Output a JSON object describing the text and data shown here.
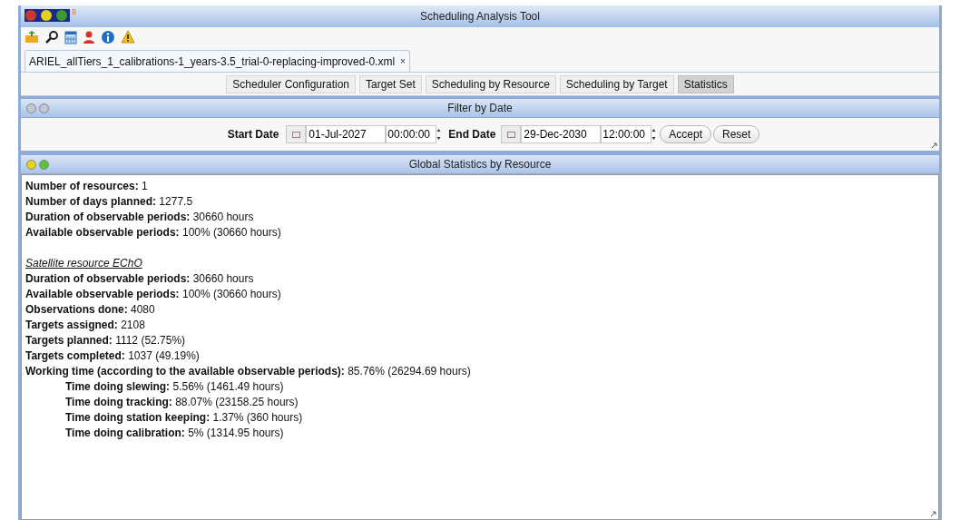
{
  "window": {
    "title": "Scheduling Analysis Tool",
    "logo_mark": "9"
  },
  "file_tab": {
    "label": "ARIEL_allTiers_1_calibrations-1_years-3.5_trial-0-replacing-improved-0.xml",
    "close": "×",
    "selected": true
  },
  "tabs": [
    {
      "label": "Scheduler Configuration",
      "selected": false
    },
    {
      "label": "Target Set",
      "selected": false
    },
    {
      "label": "Scheduling by Resource",
      "selected": false
    },
    {
      "label": "Scheduling by Target",
      "selected": false
    },
    {
      "label": "Statistics",
      "selected": true
    }
  ],
  "filter_panel": {
    "title": "Filter by Date",
    "dots": [
      {
        "color": "#c3c8d0"
      },
      {
        "color": "#c3c8d0"
      }
    ],
    "start_label": "Start Date",
    "start_date": "01-Jul-2027",
    "start_time": "00:00:00",
    "end_label": "End Date",
    "end_date": "29-Dec-2030",
    "end_time": "12:00:00",
    "buttons": [
      "Accept",
      "Reset"
    ]
  },
  "stats_panel": {
    "title": "Global Statistics by Resource",
    "dots": [
      {
        "color": "#e8d21a"
      },
      {
        "color": "#5cc23a"
      }
    ],
    "lines": [
      {
        "kind": "stat",
        "text": "**Number of resources:** 1"
      },
      {
        "kind": "stat",
        "text": "**Number of days planned:** 1277.5"
      },
      {
        "kind": "stat",
        "text": "**Duration of observable periods:** 30660 hours"
      },
      {
        "kind": "stat",
        "text": "**Available observable periods:** 100% (30660 hours)"
      },
      {
        "kind": "heading",
        "text": "Satellite resource EChO"
      },
      {
        "kind": "stat",
        "text": "**Duration of observable periods:** 30660 hours"
      },
      {
        "kind": "stat",
        "text": "**Available observable periods:** 100% (30660 hours)"
      },
      {
        "kind": "stat",
        "text": "**Observations done:** 4080"
      },
      {
        "kind": "stat",
        "text": "**Targets assigned:** 2108"
      },
      {
        "kind": "stat",
        "text": "**Targets planned:** 1112 (52.75%)"
      },
      {
        "kind": "stat",
        "text": "**Targets completed:** 1037 (49.19%)"
      },
      {
        "kind": "stat",
        "text": "**Working time (according to the available observable periods):** 85.76% (26294.69 hours)",
        "children": [
          {
            "kind": "stat",
            "text": "**Time doing slewing:** 5.56% (1461.49 hours)"
          },
          {
            "kind": "stat",
            "text": "**Time doing tracking:** 88.07% (23158.25 hours)"
          },
          {
            "kind": "stat",
            "text": "**Time doing station keeping:** 1.37% (360 hours)"
          },
          {
            "kind": "stat",
            "text": "**Time doing calibration:** 5% (1314.95 hours)"
          }
        ]
      }
    ]
  }
}
